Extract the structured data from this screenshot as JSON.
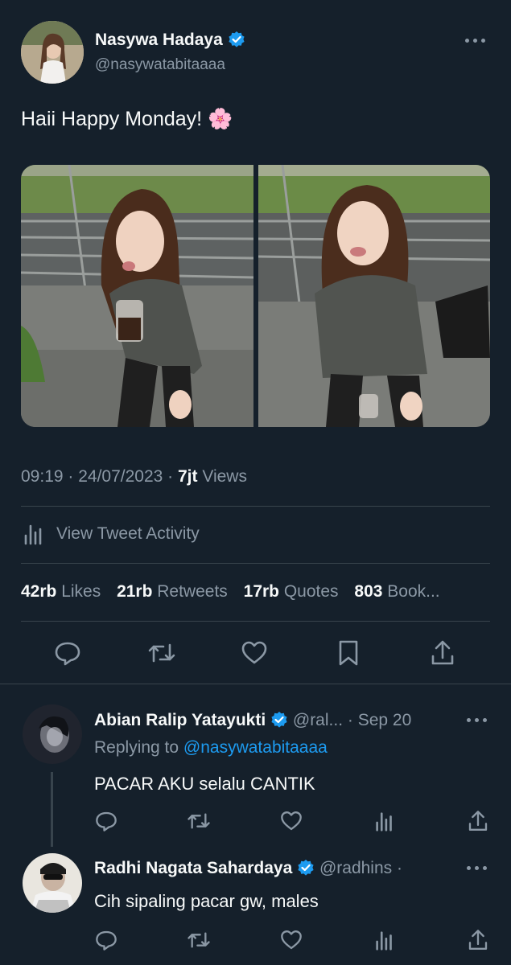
{
  "tweet": {
    "author": {
      "name": "Nasywa Hadaya",
      "handle": "@nasywatabitaaaa",
      "avatar_color": "#c9a98a"
    },
    "text": "Haii Happy Monday! 🌸",
    "timestamp": "09:19 · 24/07/2023 · ",
    "views_count": "7jt",
    "views_label": " Views",
    "activity_label": "View Tweet Activity",
    "stats": [
      {
        "count": "42rb",
        "label": " Likes"
      },
      {
        "count": "21rb",
        "label": " Retweets"
      },
      {
        "count": "17rb",
        "label": " Quotes"
      },
      {
        "count": "803",
        "label": " Book..."
      }
    ],
    "actions": {
      "reply": "reply-icon",
      "retweet": "retweet-icon",
      "like": "heart-icon",
      "bookmark": "bookmark-icon",
      "share": "share-icon"
    }
  },
  "replies": [
    {
      "name": "Abian Ralip Yatayukti",
      "handle_meta": "@ral... · Sep 20",
      "replying_prefix": "Replying to ",
      "replying_to": "@nasywatabitaaaa",
      "text": "PACAR AKU selalu CANTIK"
    },
    {
      "name": "Radhi Nagata Sahardaya",
      "handle_meta": "@radhins ·",
      "text": "Cih sipaling pacar gw, males"
    }
  ],
  "colors": {
    "background": "#15202b",
    "accent": "#1d9bf0",
    "muted": "#8b98a5",
    "divider": "#38444d"
  }
}
